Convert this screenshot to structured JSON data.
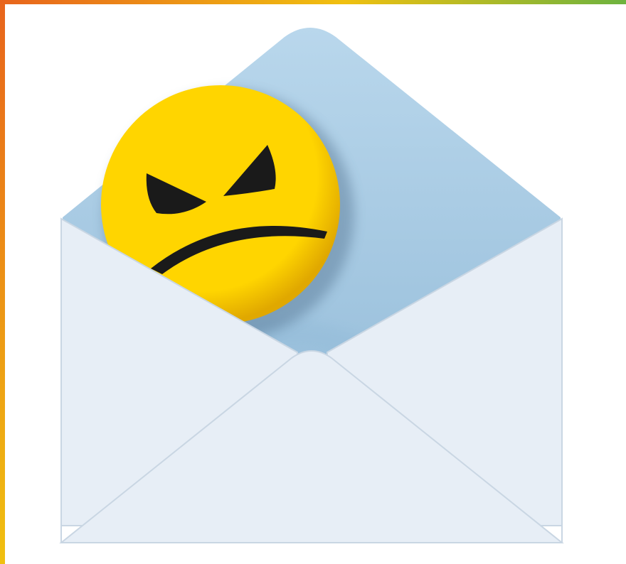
{
  "image": {
    "subject": "angry-face-in-envelope",
    "icons": [
      "envelope-icon",
      "angry-face-icon"
    ]
  },
  "colors": {
    "frame_orange": "#e8641c",
    "frame_yellow": "#f0c010",
    "frame_green": "#6db33f",
    "face_yellow": "#ffd500",
    "face_shade": "#e0a800",
    "face_features": "#1a1a1a",
    "envelope_inner": "#b9d7ec",
    "envelope_inner_shadow": "#8fb8d6",
    "envelope_body": "#e7eef6",
    "envelope_edge": "#c9d6e3",
    "background": "#ffffff"
  }
}
